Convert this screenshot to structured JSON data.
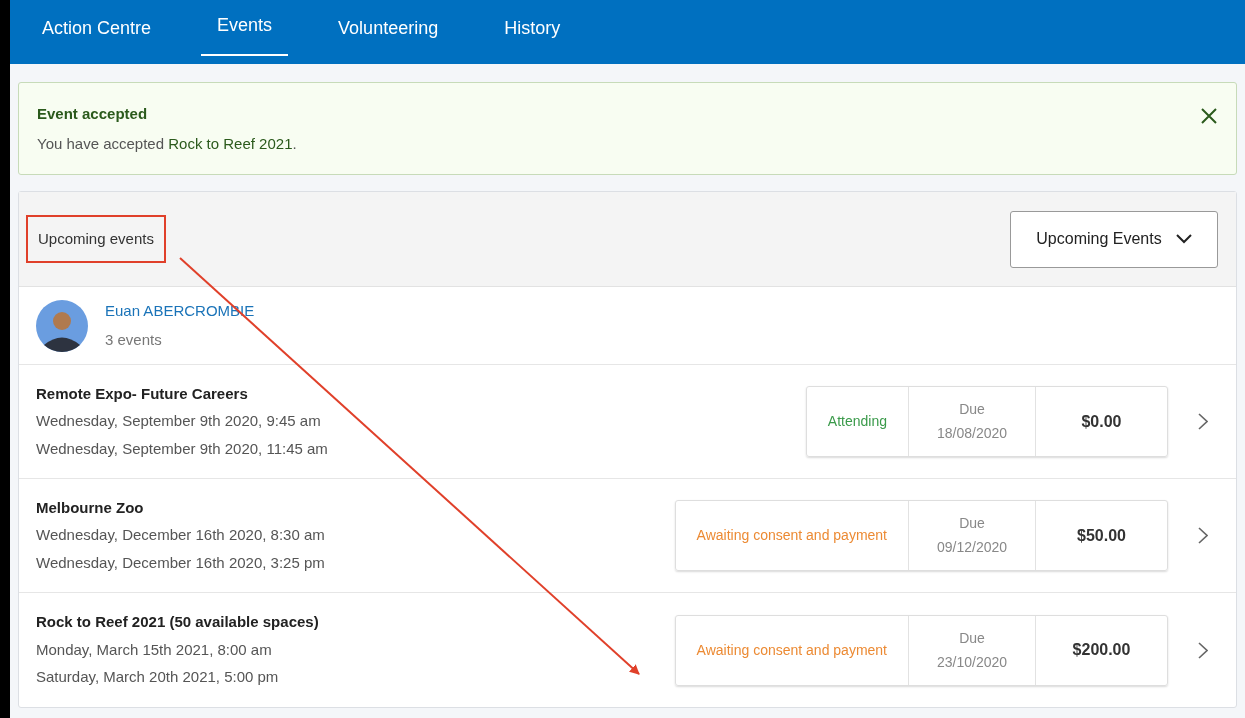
{
  "nav": {
    "tabs": [
      {
        "label": "Action Centre",
        "selected": false
      },
      {
        "label": "Events",
        "selected": true
      },
      {
        "label": "Volunteering",
        "selected": false
      },
      {
        "label": "History",
        "selected": false
      }
    ]
  },
  "alert": {
    "title": "Event accepted",
    "message": "You have accepted **Rock to Reef 2021**."
  },
  "events_panel": {
    "heading": "Upcoming events",
    "highlighted": true,
    "filter": "Upcoming Events",
    "person": {
      "name": "Euan ABERCROMBIE",
      "count": "3 events"
    },
    "events": [
      {
        "title": "Remote Expo- Future Careers",
        "start": "Wednesday, September 9th 2020, 9:45 am",
        "end": "Wednesday, September 9th 2020, 11:45 am",
        "status": "Attending",
        "kind": "attending",
        "due_label": "Due",
        "due_date": "18/08/2020",
        "price": "$0.00"
      },
      {
        "title": "Melbourne Zoo",
        "start": "Wednesday, December 16th 2020, 8:30 am",
        "end": "Wednesday, December 16th 2020, 3:25 pm",
        "status": "Awaiting consent and payment",
        "kind": "awaiting",
        "due_label": "Due",
        "due_date": "09/12/2020",
        "price": "$50.00"
      },
      {
        "title": "Rock to Reef 2021 (50 available spaces)",
        "start": "Monday, March 15th 2021, 8:00 am",
        "end": "Saturday, March 20th 2021, 5:00 pm",
        "status": "Awaiting consent and payment",
        "kind": "awaiting",
        "due_label": "Due",
        "due_date": "23/10/2020",
        "price": "$200.00"
      }
    ]
  }
}
